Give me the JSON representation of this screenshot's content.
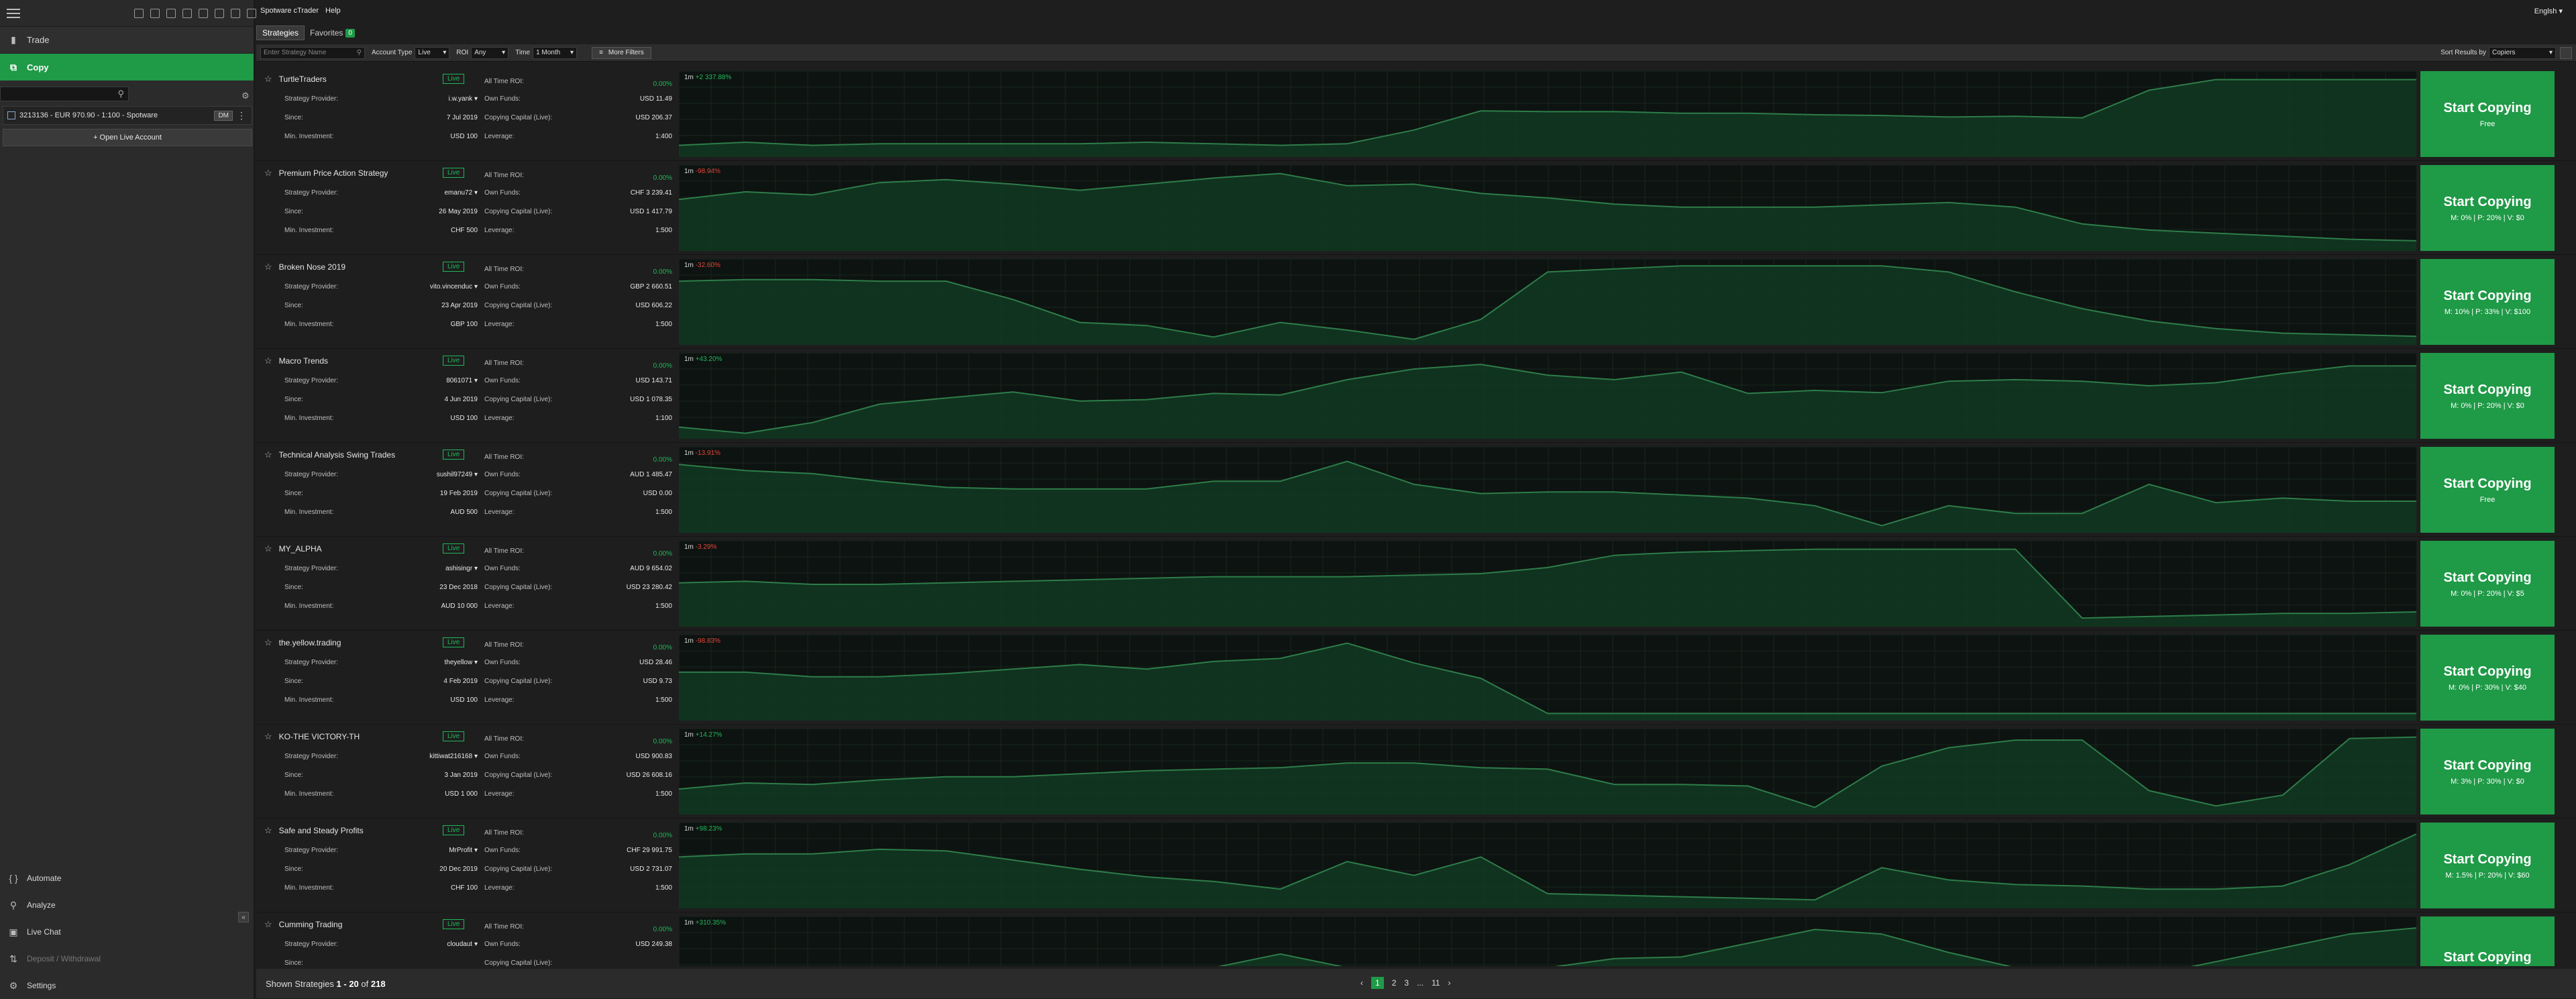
{
  "app": {
    "brand": "Spotware cTrader",
    "menu_help": "Help",
    "language": "Englsh"
  },
  "sidebar": {
    "nav": [
      {
        "label": "Trade",
        "icon": "trade-icon"
      },
      {
        "label": "Copy",
        "icon": "copy-icon"
      }
    ],
    "account": {
      "label": "3213136 - EUR 970.90 - 1:100 - Spotware",
      "badge": "DM"
    },
    "open_live": "+ Open Live Account",
    "bottom": [
      {
        "label": "Automate"
      },
      {
        "label": "Analyze"
      },
      {
        "label": "Live Chat"
      },
      {
        "label": "Deposit / Withdrawal"
      },
      {
        "label": "Settings"
      }
    ]
  },
  "tabs": {
    "strategies": "Strategies",
    "favorites": "Favorites",
    "favorites_count": "0"
  },
  "filters": {
    "search_placeholder": "Enter Strategy Name",
    "account_type_label": "Account Type",
    "account_type": "Live",
    "roi_label": "ROI",
    "roi": "Any",
    "time_label": "Time",
    "time": "1 Month",
    "more_filters": "More Filters",
    "sort_label": "Sort Results by",
    "sort": "Copiers"
  },
  "labels": {
    "provider": "Strategy Provider:",
    "since": "Since:",
    "min_invest": "Min. Investment:",
    "roi": "All Time ROI:",
    "own_funds": "Own Funds:",
    "copying_capital": "Copying Capital (Live):",
    "leverage": "Leverage:",
    "live": "Live",
    "start_copying": "Start Copying",
    "period": "1m"
  },
  "strategies": [
    {
      "name": "TurtleTraders",
      "provider": "i.w.yank",
      "since": "7 Jul 2019",
      "min_invest": "USD 100",
      "roi": "0.00%",
      "own_funds": "USD 11.49",
      "copying_capital": "USD 206.37",
      "leverage": "1:400",
      "change": "+2 337.88%",
      "fees": "Free",
      "chart": [
        0.1,
        0.14,
        0.1,
        0.12,
        0.12,
        0.12,
        0.12,
        0.14,
        0.12,
        0.1,
        0.12,
        0.3,
        0.55,
        0.54,
        0.54,
        0.52,
        0.52,
        0.5,
        0.49,
        0.47,
        0.48,
        0.46,
        0.82,
        0.96,
        0.96,
        0.96,
        0.96
      ]
    },
    {
      "name": "Premium Price Action Strategy",
      "provider": "emanu72",
      "since": "26 May 2019",
      "min_invest": "CHF 500",
      "roi": "0.00%",
      "own_funds": "CHF 3 239.41",
      "copying_capital": "USD 1 417.79",
      "leverage": "1:500",
      "change": "-98.94%",
      "fees": "M: 0% | P: 20% | V: $0",
      "chart": [
        0.62,
        0.72,
        0.68,
        0.84,
        0.88,
        0.82,
        0.74,
        0.82,
        0.9,
        0.96,
        0.8,
        0.82,
        0.7,
        0.64,
        0.56,
        0.52,
        0.52,
        0.52,
        0.55,
        0.58,
        0.52,
        0.3,
        0.22,
        0.18,
        0.14,
        0.1,
        0.08
      ]
    },
    {
      "name": "Broken Nose 2019",
      "provider": "vito.vincenduc",
      "since": "23 Apr 2019",
      "min_invest": "GBP 100",
      "roi": "0.00%",
      "own_funds": "GBP 2 660.51",
      "copying_capital": "USD 606.22",
      "leverage": "1:500",
      "change": "-32.60%",
      "fees": "M: 10% | P: 33% | V: $100",
      "chart": [
        0.78,
        0.8,
        0.8,
        0.78,
        0.78,
        0.54,
        0.24,
        0.2,
        0.05,
        0.24,
        0.14,
        0.02,
        0.28,
        0.9,
        0.94,
        0.98,
        0.98,
        0.98,
        0.98,
        0.9,
        0.64,
        0.42,
        0.26,
        0.16,
        0.1,
        0.08,
        0.06
      ]
    },
    {
      "name": "Macro Trends",
      "provider": "8061071",
      "since": "4 Jun 2019",
      "min_invest": "USD 100",
      "roi": "0.00%",
      "own_funds": "USD 143.71",
      "copying_capital": "USD 1 078.35",
      "leverage": "1:100",
      "change": "+43.20%",
      "fees": "M: 0% | P: 20% | V: $0",
      "chart": [
        0.1,
        0.02,
        0.16,
        0.4,
        0.48,
        0.56,
        0.44,
        0.46,
        0.54,
        0.52,
        0.72,
        0.86,
        0.92,
        0.78,
        0.72,
        0.82,
        0.54,
        0.58,
        0.55,
        0.7,
        0.72,
        0.7,
        0.64,
        0.68,
        0.8,
        0.9,
        0.9
      ]
    },
    {
      "name": "Technical Analysis Swing Trades",
      "provider": "sushil97249",
      "since": "19 Feb 2019",
      "min_invest": "AUD 500",
      "roi": "0.00%",
      "own_funds": "AUD 1 485.47",
      "copying_capital": "USD 0.00",
      "leverage": "1:500",
      "change": "-13.91%",
      "fees": "Free",
      "chart": [
        0.84,
        0.76,
        0.72,
        0.62,
        0.54,
        0.52,
        0.52,
        0.52,
        0.62,
        0.62,
        0.88,
        0.58,
        0.46,
        0.48,
        0.48,
        0.44,
        0.4,
        0.3,
        0.04,
        0.3,
        0.2,
        0.2,
        0.58,
        0.34,
        0.4,
        0.36,
        0.36
      ]
    },
    {
      "name": "MY_ALPHA",
      "provider": "ashisingr",
      "since": "23 Dec 2018",
      "min_invest": "AUD 10 000",
      "roi": "0.00%",
      "own_funds": "AUD 9 654.02",
      "copying_capital": "USD 23 280.42",
      "leverage": "1:500",
      "change": "-3.29%",
      "fees": "M: 0% | P: 20% | V: $5",
      "chart": [
        0.52,
        0.54,
        0.5,
        0.5,
        0.52,
        0.54,
        0.56,
        0.58,
        0.6,
        0.6,
        0.6,
        0.62,
        0.64,
        0.72,
        0.88,
        0.92,
        0.94,
        0.96,
        0.96,
        0.96,
        0.96,
        0.06,
        0.08,
        0.1,
        0.12,
        0.12,
        0.14
      ]
    },
    {
      "name": "the.yellow.trading",
      "provider": "theyellow",
      "since": "4 Feb 2019",
      "min_invest": "USD 100",
      "roi": "0.00%",
      "own_funds": "USD 28.46",
      "copying_capital": "USD 9.73",
      "leverage": "1:500",
      "change": "-98.83%",
      "fees": "M: 0% | P: 30% | V: $40",
      "chart": [
        0.58,
        0.58,
        0.52,
        0.52,
        0.56,
        0.62,
        0.68,
        0.62,
        0.72,
        0.76,
        0.96,
        0.7,
        0.5,
        0.04,
        0.04,
        0.04,
        0.04,
        0.04,
        0.04,
        0.04,
        0.04,
        0.04,
        0.04,
        0.04,
        0.04,
        0.04,
        0.04
      ]
    },
    {
      "name": "KO-THE VICTORY-TH",
      "provider": "kittiwat216168",
      "since": "3 Jan 2019",
      "min_invest": "USD 1 000",
      "roi": "0.00%",
      "own_funds": "USD 900.83",
      "copying_capital": "USD 26 608.16",
      "leverage": "1:500",
      "change": "+14.27%",
      "fees": "M: 3% | P: 30% | V: $0",
      "chart": [
        0.28,
        0.36,
        0.34,
        0.4,
        0.44,
        0.44,
        0.48,
        0.52,
        0.54,
        0.56,
        0.62,
        0.62,
        0.56,
        0.54,
        0.34,
        0.34,
        0.32,
        0.04,
        0.58,
        0.82,
        0.92,
        0.92,
        0.26,
        0.06,
        0.2,
        0.94,
        0.96
      ]
    },
    {
      "name": "Safe and Steady Profits",
      "provider": "MrProfit",
      "since": "20 Dec 2019",
      "min_invest": "CHF 100",
      "roi": "0.00%",
      "own_funds": "CHF 29 991.75",
      "copying_capital": "USD 2 731.07",
      "leverage": "1:500",
      "change": "+98.23%",
      "fees": "M: 1.5% | P: 20% | V: $60",
      "chart": [
        0.62,
        0.66,
        0.66,
        0.72,
        0.7,
        0.58,
        0.46,
        0.36,
        0.3,
        0.2,
        0.56,
        0.38,
        0.62,
        0.14,
        0.12,
        0.1,
        0.08,
        0.06,
        0.48,
        0.32,
        0.26,
        0.24,
        0.2,
        0.2,
        0.24,
        0.52,
        0.92
      ]
    },
    {
      "name": "Cumming Trading",
      "provider": "cloudaut",
      "since": "",
      "min_invest": "",
      "roi": "0.00%",
      "own_funds": "USD 249.38",
      "copying_capital": "",
      "leverage": "",
      "change": "+310.35%",
      "fees": "",
      "chart": [
        0.2,
        0.22,
        0.22,
        0.34,
        0.3,
        0.36,
        0.34,
        0.36,
        0.4,
        0.58,
        0.4,
        0.38,
        0.36,
        0.4,
        0.52,
        0.54,
        0.72,
        0.9,
        0.84,
        0.6,
        0.4,
        0.2,
        0.3,
        0.48,
        0.66,
        0.84,
        0.92
      ]
    }
  ],
  "footer": {
    "shown": "Shown Strategies",
    "range": "1 - 20",
    "of": "of",
    "total": "218",
    "pages": [
      "1",
      "2",
      "3",
      "...",
      "11"
    ]
  }
}
